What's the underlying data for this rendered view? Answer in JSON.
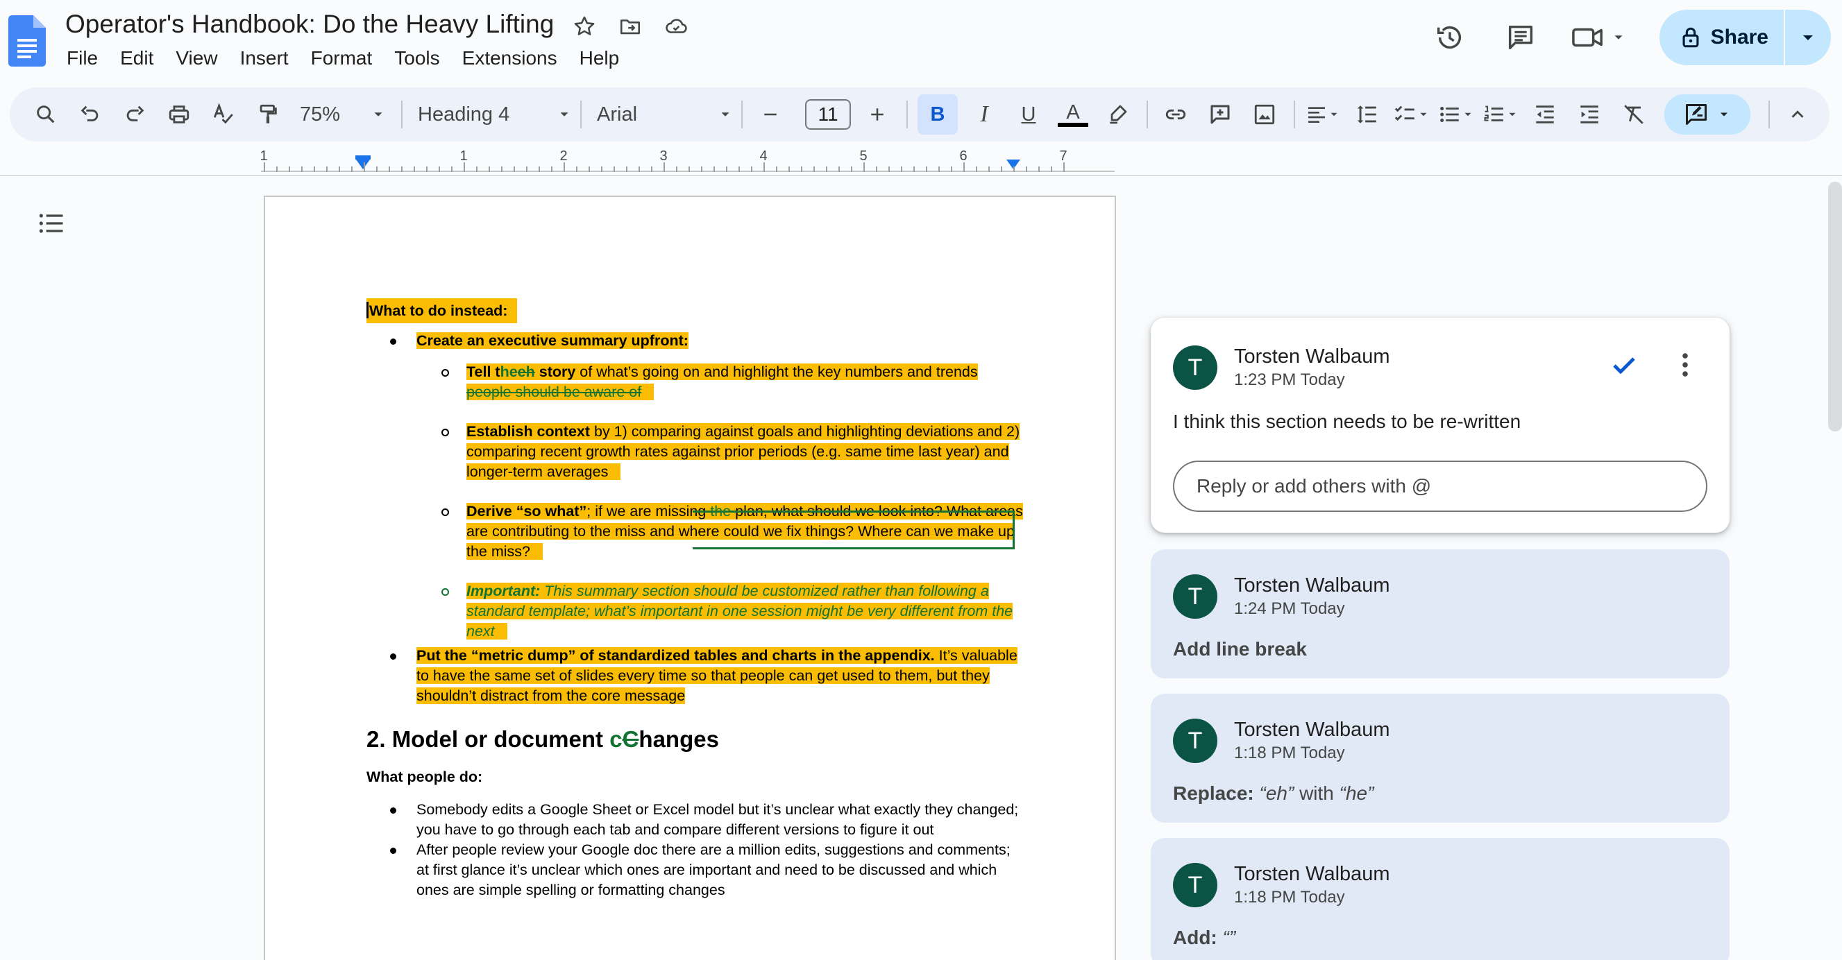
{
  "app": {
    "title": "Operator's Handbook: Do the Heavy Lifting",
    "menu": [
      "File",
      "Edit",
      "View",
      "Insert",
      "Format",
      "Tools",
      "Extensions",
      "Help"
    ],
    "share_label": "Share",
    "accent_color": "#0b57d0",
    "share_bg": "#c2e7ff"
  },
  "toolbar": {
    "zoom": "75%",
    "style": "Heading 4",
    "font": "Arial",
    "font_size": "11",
    "bold": "B",
    "italic": "I",
    "underline": "U",
    "text_color": "A"
  },
  "ruler": {
    "labels": [
      "1",
      "1",
      "2",
      "3",
      "4",
      "5",
      "6",
      "7"
    ]
  },
  "document": {
    "highlight_color": "#fbbc04",
    "suggestion_color": "#137333",
    "section_heading": "What to do instead:",
    "item1": "Create an executive summary upfront:",
    "sub1_bold_a": "Tell t",
    "sub1_ins": "he",
    "sub1_del": "eh",
    "sub1_bold_b": " story",
    "sub1_rest": " of what’s going on and highlight the key numbers and trends ",
    "sub1_deleted": "people should be aware of",
    "sub2_bold": "Establish context",
    "sub2_rest": " by 1) comparing against goals and highlighting deviations and 2) comparing recent growth rates against prior periods (e.g. same time last year) and longer-term averages",
    "sub3_bold": "Derive “so what”",
    "sub3_a": "; if we are missing ",
    "sub3_ins": "the",
    "sub3_b": " plan, what should we look into? What areas are contributing to the miss and where could we fix things? Where can we make up the miss?",
    "sub4_bold": "Important:",
    "sub4_rest": " This summary section should be customized rather than following a standard template; what’s important in one session might be very different from the next",
    "item2_bold": "Put the “metric dump” of standardized tables and charts in the appendix.",
    "item2_rest": " It’s valuable to have the same set of slides every time so that people can get used to them, but they shouldn’t distract from the core message",
    "h2_a": "2. Model or document ",
    "h2_ins": "c",
    "h2_del": "C",
    "h2_b": "hanges",
    "h4": "What people do:",
    "bullet_a": "Somebody edits a Google Sheet or Excel model but it’s unclear what exactly they changed; you have to go through each tab and compare different versions to figure it out",
    "bullet_b": "After people review your Google doc there are a million edits, suggestions and comments; at first glance it’s unclear which ones are important and need to be discussed and which ones are simple spelling or formatting changes"
  },
  "comments": [
    {
      "avatar": "T",
      "author": "Torsten Walbaum",
      "time": "1:23 PM Today",
      "text": "I think this section needs to be re-written",
      "reply_placeholder": "Reply or add others with @"
    },
    {
      "avatar": "T",
      "author": "Torsten Walbaum",
      "time": "1:24 PM Today",
      "action": "Add line break"
    },
    {
      "avatar": "T",
      "author": "Torsten Walbaum",
      "time": "1:18 PM Today",
      "action": "Replace:",
      "old": "“eh”",
      "with": " with ",
      "new": "“he”"
    },
    {
      "avatar": "T",
      "author": "Torsten Walbaum",
      "time": "1:18 PM Today",
      "action": "Add:",
      "new": "“”"
    }
  ]
}
